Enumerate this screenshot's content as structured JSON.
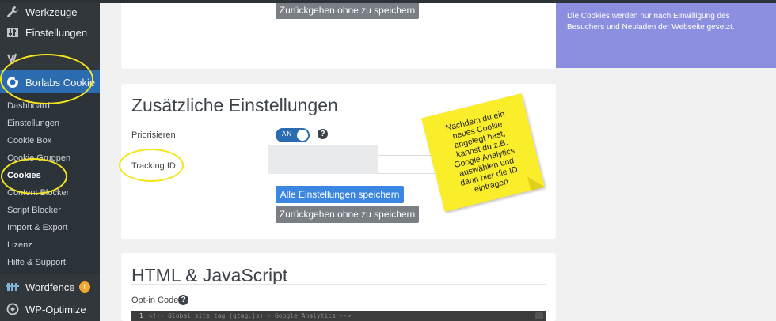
{
  "sidebar": {
    "items": [
      {
        "label": "Werkzeuge",
        "icon": "wrench-icon"
      },
      {
        "label": "Einstellungen",
        "icon": "settings-icon"
      },
      {
        "label": "",
        "icon": "yoast-icon"
      },
      {
        "label": "Borlabs Cookie",
        "icon": "borlabs-cookie-icon"
      }
    ],
    "submenu": [
      "Dashboard",
      "Einstellungen",
      "Cookie Box",
      "Cookie Gruppen",
      "Cookies",
      "Content Blocker",
      "Script Blocker",
      "Import & Export",
      "Lizenz",
      "Hilfe & Support"
    ],
    "bottom_items": [
      {
        "label": "Wordfence",
        "icon": "wordfence-icon",
        "badge": "1"
      },
      {
        "label": "WP-Optimize",
        "icon": "wp-optimize-icon"
      }
    ]
  },
  "top_card": {
    "back_button": "Zurückgehen ohne zu speichern"
  },
  "settings_card": {
    "title": "Zusätzliche Einstellungen",
    "priority_label": "Priorisieren",
    "toggle_state": "AN",
    "tracking_label": "Tracking ID",
    "tracking_value": "",
    "save_button": "Alle Einstellungen speichern",
    "back_button": "Zurückgehen ohne zu speichern"
  },
  "html_card": {
    "title": "HTML & JavaScript",
    "optin_label": "Opt-in Code",
    "code_line_number": "1",
    "code_line": "<!-- Global site tag (gtag.js) - Google Analytics -->"
  },
  "notice": {
    "text": "Die Cookies werden nur nach Einwilligung des Besuchers und Neuladen der Webseite gesetzt."
  },
  "annotation": {
    "sticky_note": "Nachdem du ein\nneues Cookie\nangelegt hast,\nkannst du z.B.\nGoogle Analytics\nauswählen und\ndann hier die ID\neintragen",
    "highlight_color": "#f4e51c",
    "note_color": "#faed2a"
  },
  "colors": {
    "sidebar_bg": "#32373c",
    "active_bg": "#2b6cb0",
    "primary_button": "#3a86e0",
    "secondary_button": "#7a7f85",
    "notice_bg": "#8c8fe0"
  }
}
